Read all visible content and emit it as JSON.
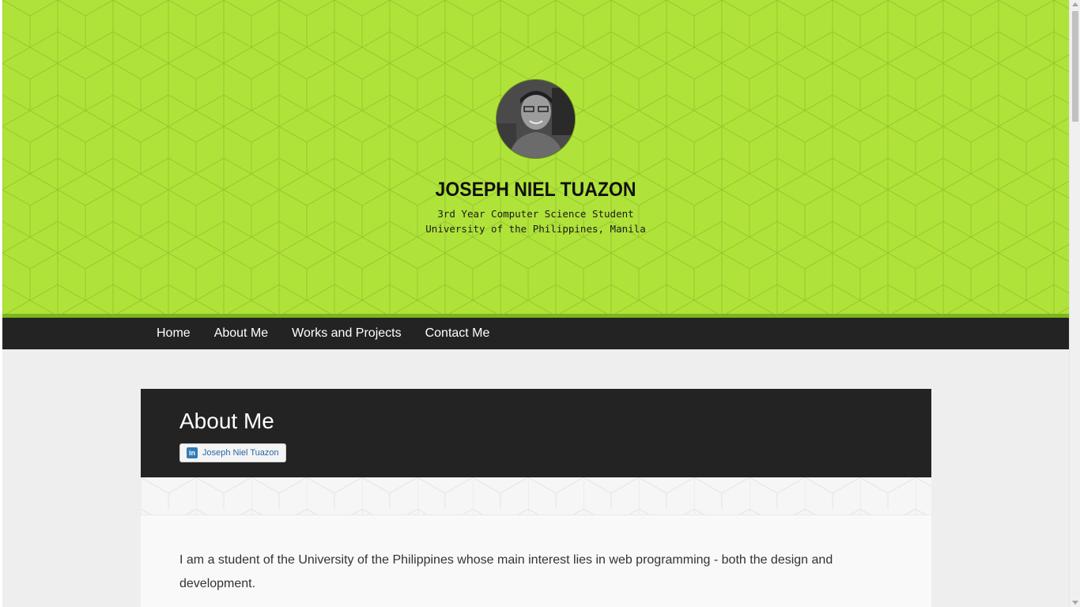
{
  "header": {
    "name": "JOSEPH NIEL TUAZON",
    "tagline_line1": "3rd Year Computer Science Student",
    "tagline_line2": "University of the Philippines, Manila",
    "accent_color": "#b0e33a"
  },
  "nav": {
    "items": [
      "Home",
      "About Me",
      "Works and Projects",
      "Contact Me"
    ]
  },
  "about": {
    "title": "About Me",
    "linkedin_label": "Joseph Niel Tuazon",
    "linkedin_icon": "linkedin-icon",
    "body": "I am a student of the University of the Philippines whose main interest lies in web programming - both the design and development."
  }
}
